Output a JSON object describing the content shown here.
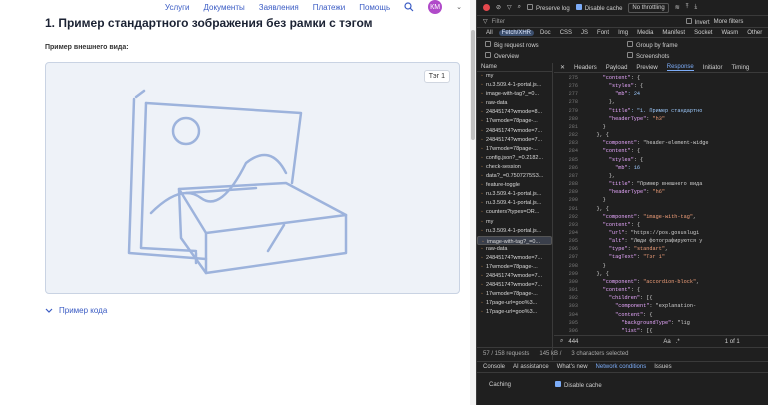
{
  "nav": {
    "items": [
      "Услуги",
      "Документы",
      "Заявления",
      "Платежи",
      "Помощь"
    ],
    "avatar": "КМ"
  },
  "page": {
    "title": "1. Пример стандартного зображения без рамки с тэгом",
    "subtitle": "Пример внешнего вида:",
    "tag": "Тэг 1",
    "code_link": "Пример кода"
  },
  "devtools": {
    "toolbar": {
      "preserve_log": "Preserve log",
      "disable_cache": "Disable cache",
      "throttling": "No throttling"
    },
    "filter": {
      "placeholder": "Filter",
      "invert": "Invert",
      "more_filters": "More filters"
    },
    "types": [
      "All",
      "Fetch/XHR",
      "Doc",
      "CSS",
      "JS",
      "Font",
      "Img",
      "Media",
      "Manifest",
      "Socket",
      "Wasm",
      "Other"
    ],
    "options": {
      "big_rows": "Big request rows",
      "overview": "Overview",
      "group_frame": "Group by frame",
      "screenshots": "Screenshots"
    },
    "names_header": "Name",
    "requests": [
      "my",
      "ru.3.509.4-1-portal.js...",
      "image-with-tag?_=0...",
      "raw-data",
      "24845174?wmode=8...",
      "17wmode=78page-...",
      "24845174?wmode=7...",
      "24845174?wmode=7...",
      "17wmode=78page-...",
      "config.json?_=0.2182...",
      "check-session",
      "data?_=0.7507275S3...",
      "feature-toggle",
      "ru.3.509.4-1-portal.js...",
      "ru.3.509.4-1-portal.js...",
      "counters?types=OR...",
      "my",
      "ru.3.509.4-1-portal.js...",
      "image-with-tag?_=0...",
      "raw-data",
      "24845174?wmode=7...",
      "17wmode=78page-...",
      "24845174?wmode=7...",
      "24845174?wmode=7...",
      "17wmode=78page-...",
      "17page-url=goo%3...",
      "17page-url=goo%3..."
    ],
    "tabs": [
      "Headers",
      "Payload",
      "Preview",
      "Response",
      "Initiator",
      "Timing"
    ],
    "active_tab": "Response",
    "lines": [
      {
        "n": "275",
        "t": "      \"content\": {"
      },
      {
        "n": "276",
        "t": "        \"styles\": {"
      },
      {
        "n": "277",
        "t": "          \"mb\": 24"
      },
      {
        "n": "278",
        "t": "        },"
      },
      {
        "n": "279",
        "t": "        \"title\": \"1. Пример стандартно"
      },
      {
        "n": "280",
        "t": "        \"headerType\": \"h3\""
      },
      {
        "n": "281",
        "t": "      }"
      },
      {
        "n": "282",
        "t": "    }, {"
      },
      {
        "n": "283",
        "t": "      \"component\": \"header-element-widge"
      },
      {
        "n": "284",
        "t": "      \"content\": {"
      },
      {
        "n": "285",
        "t": "        \"styles\": {"
      },
      {
        "n": "286",
        "t": "          \"mb\": 16"
      },
      {
        "n": "287",
        "t": "        },"
      },
      {
        "n": "288",
        "t": "        \"title\": \"Пример внешнего вида"
      },
      {
        "n": "289",
        "t": "        \"headerType\": \"h6\""
      },
      {
        "n": "290",
        "t": "      }"
      },
      {
        "n": "291",
        "t": "    }, {"
      },
      {
        "n": "292",
        "t": "      \"component\": \"image-with-tag\","
      },
      {
        "n": "293",
        "t": "      \"content\": {"
      },
      {
        "n": "294",
        "t": "        \"url\": \"https://pos.gosuslugi"
      },
      {
        "n": "295",
        "t": "        \"alt\": \"Люди фотографируются у"
      },
      {
        "n": "296",
        "t": "        \"type\": \"standart\","
      },
      {
        "n": "297",
        "t": "        \"tagText\": \"Тэг 1\""
      },
      {
        "n": "298",
        "t": "      }"
      },
      {
        "n": "299",
        "t": "    }, {"
      },
      {
        "n": "300",
        "t": "      \"component\": \"accordion-block\","
      },
      {
        "n": "301",
        "t": "      \"content\": {"
      },
      {
        "n": "302",
        "t": "        \"children\": [{"
      },
      {
        "n": "303",
        "t": "          \"component\": \"explanation-"
      },
      {
        "n": "304",
        "t": "          \"content\": {"
      },
      {
        "n": "305",
        "t": "            \"backgroundType\": \"lig"
      },
      {
        "n": "306",
        "t": "            \"list\": [{"
      },
      {
        "n": "307",
        "t": "              \"text\": \"<pre>{\\n"
      }
    ],
    "search": {
      "value": "444",
      "matches": "1 of 1"
    },
    "status": {
      "requests": "57 / 158 requests",
      "size": "145 kB /",
      "selected": "3 characters selected"
    },
    "drawer_tabs": [
      "Console",
      "AI assistance",
      "What's new",
      "Network conditions",
      "Issues"
    ],
    "active_drawer": "Network conditions",
    "caching": {
      "label": "Caching",
      "disable": "Disable cache"
    }
  }
}
